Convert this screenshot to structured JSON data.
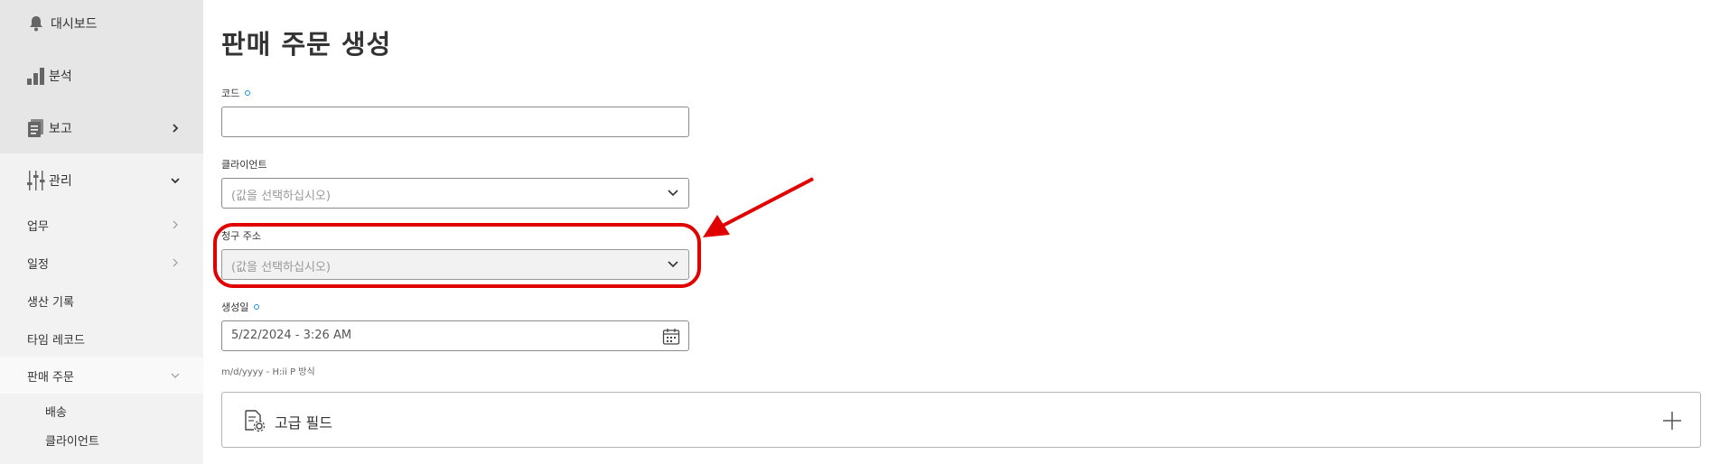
{
  "sidebar": {
    "items": [
      {
        "label": "대시보드",
        "icon": "bell-icon"
      },
      {
        "label": "분석",
        "icon": "bar-chart-icon"
      },
      {
        "label": "보고",
        "icon": "document-icon"
      },
      {
        "label": "관리",
        "icon": "sliders-icon"
      },
      {
        "label": "업무"
      },
      {
        "label": "일정"
      },
      {
        "label": "생산 기록"
      },
      {
        "label": "타임 레코드"
      },
      {
        "label": "판매 주문"
      },
      {
        "label": "배송"
      },
      {
        "label": "클라이언트"
      }
    ]
  },
  "page": {
    "title": "판매 주문 생성"
  },
  "form": {
    "code": {
      "label": "코드",
      "value": ""
    },
    "client": {
      "label": "클라이언트",
      "placeholder": "(값을 선택하십시오)"
    },
    "billing_address": {
      "label": "청구 주소",
      "placeholder": "(값을 선택하십시오)"
    },
    "created_date": {
      "label": "생성일",
      "value": "5/22/2024 - 3:26 AM",
      "hint": "m/d/yyyy - H:ii P 방식"
    },
    "advanced": {
      "label": "고급 필드"
    }
  },
  "colors": {
    "accent": "#1d8fd8",
    "annotation": "#e00000"
  }
}
